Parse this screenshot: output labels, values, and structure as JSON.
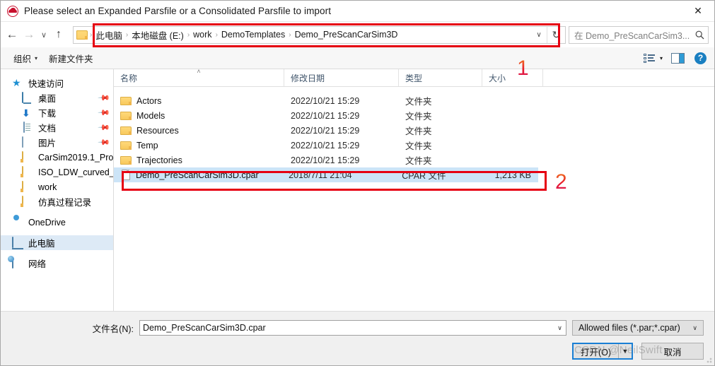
{
  "window": {
    "title": "Please select an Expanded Parsfile or a Consolidated Parsfile to import",
    "icon": "carsim-car-icon",
    "close_label": "✕"
  },
  "nav": {
    "back": "←",
    "forward": "→",
    "recent": "∨",
    "up": "↑",
    "refresh": "↻",
    "dropdown": "∨"
  },
  "address": {
    "separator": "›",
    "crumbs": [
      "此电脑",
      "本地磁盘 (E:)",
      "work",
      "DemoTemplates",
      "Demo_PreScanCarSim3D"
    ]
  },
  "search": {
    "placeholder": "在 Demo_PreScanCarSim3...",
    "icon": "search-icon"
  },
  "toolbar": {
    "organize": "组织",
    "organize_caret": "▾",
    "new_folder": "新建文件夹",
    "view_caret": "▾",
    "help": "?"
  },
  "sidebar": {
    "items": [
      {
        "label": "快速访问",
        "icon": "star-icon",
        "level": 0,
        "pinned": false,
        "selected": false
      },
      {
        "label": "桌面",
        "icon": "desktop-icon",
        "level": 1,
        "pinned": true,
        "selected": false
      },
      {
        "label": "下载",
        "icon": "download-icon",
        "level": 1,
        "pinned": true,
        "selected": false
      },
      {
        "label": "文档",
        "icon": "document-icon",
        "level": 1,
        "pinned": true,
        "selected": false
      },
      {
        "label": "图片",
        "icon": "picture-icon",
        "level": 1,
        "pinned": true,
        "selected": false
      },
      {
        "label": "CarSim2019.1_Pro",
        "icon": "folder-icon",
        "level": 1,
        "pinned": false,
        "selected": false
      },
      {
        "label": "ISO_LDW_curved_",
        "icon": "folder-icon",
        "level": 1,
        "pinned": false,
        "selected": false
      },
      {
        "label": "work",
        "icon": "folder-icon",
        "level": 1,
        "pinned": false,
        "selected": false
      },
      {
        "label": "仿真过程记录",
        "icon": "folder-icon",
        "level": 1,
        "pinned": false,
        "selected": false
      },
      {
        "label": "OneDrive",
        "icon": "onedrive-icon",
        "level": 0,
        "pinned": false,
        "selected": false
      },
      {
        "label": "此电脑",
        "icon": "this-pc-icon",
        "level": 0,
        "pinned": false,
        "selected": true
      },
      {
        "label": "网络",
        "icon": "network-icon",
        "level": 0,
        "pinned": false,
        "selected": false
      }
    ],
    "pin_glyph": "✒"
  },
  "filelist": {
    "columns": [
      "名称",
      "修改日期",
      "类型",
      "大小"
    ],
    "sort_indicator": "˄",
    "rows": [
      {
        "name": "Actors",
        "date": "2022/10/21 15:29",
        "type": "文件夹",
        "size": "",
        "kind": "folder",
        "selected": false
      },
      {
        "name": "Models",
        "date": "2022/10/21 15:29",
        "type": "文件夹",
        "size": "",
        "kind": "folder",
        "selected": false
      },
      {
        "name": "Resources",
        "date": "2022/10/21 15:29",
        "type": "文件夹",
        "size": "",
        "kind": "folder",
        "selected": false
      },
      {
        "name": "Temp",
        "date": "2022/10/21 15:29",
        "type": "文件夹",
        "size": "",
        "kind": "folder",
        "selected": false
      },
      {
        "name": "Trajectories",
        "date": "2022/10/21 15:29",
        "type": "文件夹",
        "size": "",
        "kind": "folder",
        "selected": false
      },
      {
        "name": "Demo_PreScanCarSim3D.cpar",
        "date": "2018/7/11 21:04",
        "type": "CPAR 文件",
        "size": "1,213 KB",
        "kind": "file",
        "selected": true
      }
    ]
  },
  "footer": {
    "filename_label": "文件名(N):",
    "filename_value": "Demo_PreScanCarSim3D.cpar",
    "filename_caret": "∨",
    "filter_value": "Allowed files (*.par;*.cpar)",
    "filter_caret": "∨",
    "open_label": "打开(O)",
    "open_split_caret": "▼",
    "cancel_label": "取消"
  },
  "annotations": {
    "markers": [
      "1",
      "2"
    ]
  },
  "watermark": {
    "text": "CSDN @NeilSwift"
  },
  "colors": {
    "accent": "#1a7fd4",
    "annotation": "#e60012",
    "selection": "#cce4f7",
    "sidebar_selection": "#ddeaf6"
  }
}
